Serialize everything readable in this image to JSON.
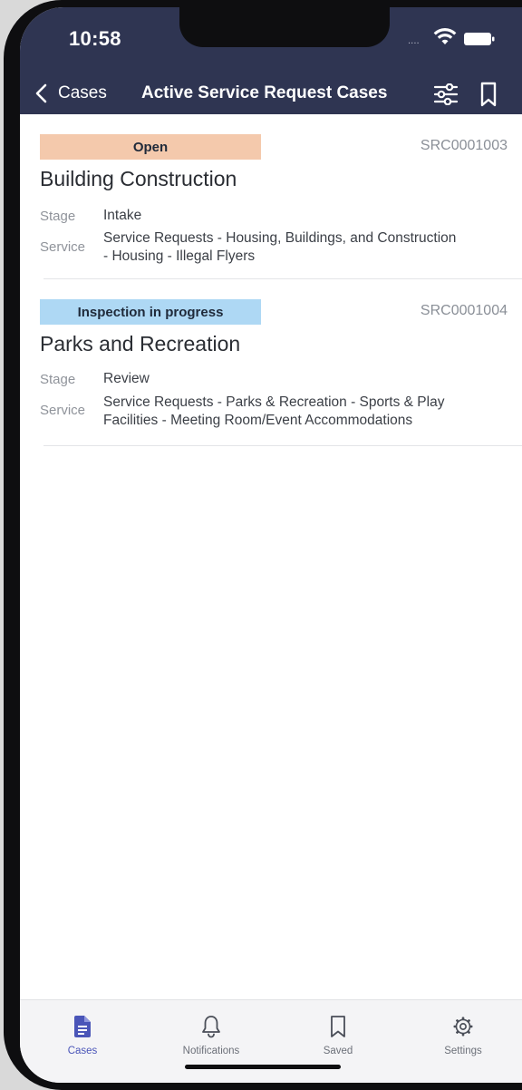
{
  "status_bar": {
    "time": "10:58",
    "signal": "....",
    "wifi_icon": "wifi-icon",
    "battery_icon": "battery-icon"
  },
  "header": {
    "back_label": "Cases",
    "title": "Active Service Request Cases",
    "background_color": "#2f3552",
    "icons": [
      "chevron-left-icon",
      "filter-sliders-icon",
      "bookmark-icon"
    ]
  },
  "cases": [
    {
      "status": "Open",
      "status_color": "#f4c9ac",
      "id": "SRC0001003",
      "title": "Building Construction",
      "stage_label": "Stage",
      "stage": "Intake",
      "service_label": "Service",
      "service_line1": "Service Requests - Housing, Buildings, and Construction",
      "service_line2": "- Housing - Illegal Flyers"
    },
    {
      "status": "Inspection in progress",
      "status_color": "#aed8f4",
      "id": "SRC0001004",
      "title": "Parks and Recreation",
      "stage_label": "Stage",
      "stage": "Review",
      "service_label": "Service",
      "service_line1": "Service Requests - Parks & Recreation - Sports & Play",
      "service_line2": "Facilities - Meeting Room/Event Accommodations"
    }
  ],
  "tab_bar": {
    "active_color": "#4a55b8",
    "tabs": [
      {
        "label": "Cases",
        "icon": "document-icon",
        "active": true
      },
      {
        "label": "Notifications",
        "icon": "bell-icon",
        "active": false
      },
      {
        "label": "Saved",
        "icon": "bookmark-icon",
        "active": false
      },
      {
        "label": "Settings",
        "icon": "gear-icon",
        "active": false
      }
    ]
  }
}
